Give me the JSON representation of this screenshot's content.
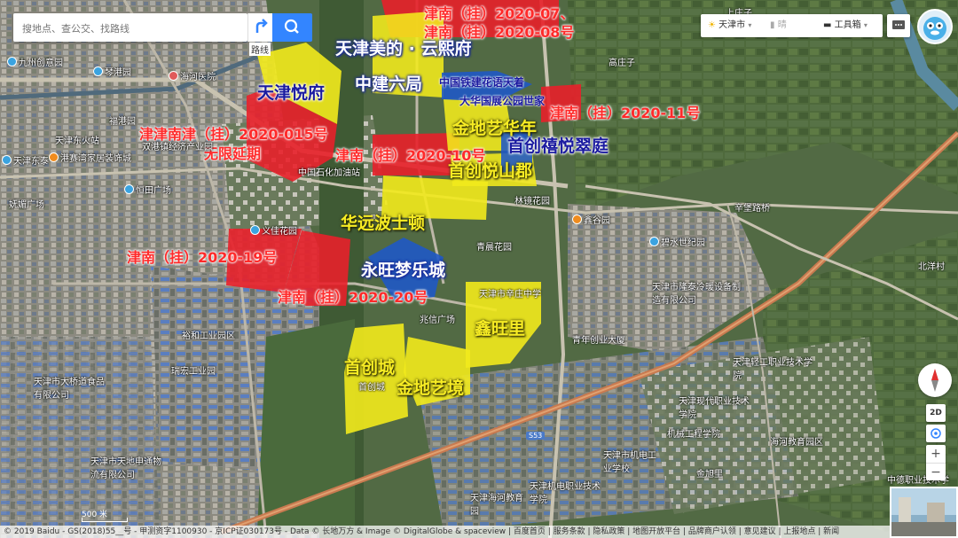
{
  "search": {
    "placeholder": "搜地点、查公交、找路线",
    "route_label": "路线"
  },
  "toolbar": {
    "city": "天津市",
    "weather": "晴",
    "tools": "工具箱"
  },
  "controls": {
    "view_2d": "2D",
    "zoom_in": "+",
    "zoom_out": "−"
  },
  "scale": {
    "label": "500 米"
  },
  "copyright": "© 2019 Baidu - GS(2018)55__号 - 甲测资字1100930 - 京ICP证030173号 - Data © 长地万方 & Image © DigitalGlobe & spaceview | 百度首页 | 服务条款 | 隐私政策 | 地图开放平台 | 品牌商户认领 | 意见建议 | 上报地点 | 新闻",
  "road_badge": "S53",
  "annotations": {
    "white": [
      {
        "id": "tianjin-meide-yunxifu",
        "text": "天津美的 · 云熙府"
      },
      {
        "id": "zhongjian-liuju",
        "text": "中建六局"
      },
      {
        "id": "yongwang-mengle",
        "text": "永旺梦乐城"
      }
    ],
    "yellow": [
      {
        "id": "jindi-yihuanian",
        "text": "金地艺华年"
      },
      {
        "id": "shouchuang-yueshanjun",
        "text": "首创悦山郡"
      },
      {
        "id": "huayuan-boshidun",
        "text": "华远波士顿"
      },
      {
        "id": "xinwangli",
        "text": "鑫旺里"
      },
      {
        "id": "shouchuang-cheng",
        "text": "首创城"
      },
      {
        "id": "jindi-yijing",
        "text": "金地艺境"
      }
    ],
    "blue": [
      {
        "id": "tianjin-yuefu",
        "text": "天津悦府"
      },
      {
        "id": "shouchuang-xiyue",
        "text": "首创禧悦翠庭"
      }
    ],
    "small_blue": [
      {
        "id": "zhongguo-tiejian",
        "text": "中国铁建花语天着"
      },
      {
        "id": "dahua-guozhan",
        "text": "大华国展公园世家"
      }
    ],
    "red": [
      {
        "id": "r-07",
        "text": "津南（挂）2020-07、"
      },
      {
        "id": "r-08",
        "text": "津南（挂）2020-08号"
      },
      {
        "id": "r-11",
        "text": "津南（挂）2020-11号"
      },
      {
        "id": "r-015",
        "text": "津津南津（挂）2020-015号"
      },
      {
        "id": "r-wuxian",
        "text": "无限延期"
      },
      {
        "id": "r-10",
        "text": "津南（挂）2020-10号"
      },
      {
        "id": "r-19",
        "text": "津南（挂）2020-19号"
      },
      {
        "id": "r-20",
        "text": "津南（挂）2020-20号"
      }
    ]
  },
  "pois": [
    {
      "id": "jiuzhou-chuangyi",
      "text": "九州创意园"
    },
    {
      "id": "gongmin-tinglan",
      "text": "琴港园"
    },
    {
      "id": "haihe-yiyuan",
      "text": "海河医院"
    },
    {
      "id": "fugang-yuan",
      "text": "福港园"
    },
    {
      "id": "tianjin-dongtai",
      "text": "天津东泰"
    },
    {
      "id": "shuanggang-jingji",
      "text": "双港镇经济产业园"
    },
    {
      "id": "tianjin-chezhan",
      "text": "天津东火站"
    },
    {
      "id": "zhuangshi",
      "text": "港赛湾家居装饰城"
    },
    {
      "id": "henggang-guangchang",
      "text": "恒田广场"
    },
    {
      "id": "kunding-guangchang",
      "text": "妩媚广场"
    },
    {
      "id": "yijia-yuan",
      "text": "义佳花园"
    },
    {
      "id": "zhongguo-shihua",
      "text": "中国石化加油站"
    },
    {
      "id": "linjing-huayuan",
      "text": "林镜花园"
    },
    {
      "id": "xinhua-yuan",
      "text": "鑫谷园"
    },
    {
      "id": "biwei-yuan",
      "text": "碧水世纪园"
    },
    {
      "id": "jinchen-huayuan",
      "text": "青晨花园"
    },
    {
      "id": "xinzhuang-zhongxue",
      "text": "天津市辛庄中学"
    },
    {
      "id": "zhaotan-guangchang",
      "text": "兆信广场"
    },
    {
      "id": "tianjin-longtai",
      "text": "天津市隆泰冷暖设备制造有限公司"
    },
    {
      "id": "qingnian-chuangye",
      "text": "青年创业大厦"
    },
    {
      "id": "yuhe-gongye",
      "text": "裕和工业园区"
    },
    {
      "id": "ruihong-gongye",
      "text": "瑞宏工业园"
    },
    {
      "id": "daqiaodao",
      "text": "天津市大桥道食品有限公司"
    },
    {
      "id": "tianjin-tiandi",
      "text": "天津市天地申通物流有限公司"
    },
    {
      "id": "tianjin-qinggong",
      "text": "天津轻工职业技术学院"
    },
    {
      "id": "tianjin-xiandai",
      "text": "天津现代职业技术学院"
    },
    {
      "id": "jixie-gongcheng",
      "text": "机械工程学院"
    },
    {
      "id": "haihe-jiaoyu",
      "text": "海河教育园区"
    },
    {
      "id": "tianjin-jidian",
      "text": "天津市机电工业学校"
    },
    {
      "id": "jinqi-li",
      "text": "金旭里"
    },
    {
      "id": "tianjin-haihe-jiaoyu",
      "text": "天津海河教育园"
    },
    {
      "id": "tianjin-jidian-zhiye",
      "text": "天津机电职业技术学院"
    },
    {
      "id": "zhongde-zhiye",
      "text": "中德职业技术学"
    },
    {
      "id": "beizhuang-cun",
      "text": "北洋村"
    },
    {
      "id": "xinhai-lu",
      "text": "辛堡路桥"
    },
    {
      "id": "gaozhuang-zi",
      "text": "高庄子"
    },
    {
      "id": "shangzhuang-zi",
      "text": "上庄子"
    },
    {
      "id": "shouchuang-cheng-small",
      "text": "首创城"
    }
  ],
  "colors": {
    "red_parcel": "#e8202a",
    "yellow_parcel": "#f2ea1c",
    "blue_parcel": "#1e58c8",
    "accent": "#3385ff"
  }
}
